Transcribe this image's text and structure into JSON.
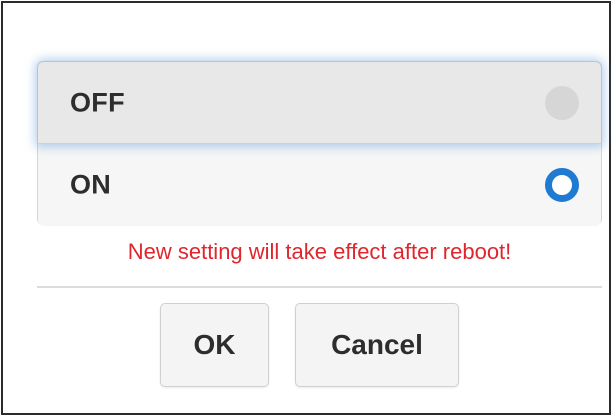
{
  "options": [
    {
      "label": "OFF",
      "selected": false
    },
    {
      "label": "ON",
      "selected": true
    }
  ],
  "notice": "New setting will take effect after reboot!",
  "buttons": {
    "ok_label": "OK",
    "cancel_label": "Cancel"
  },
  "colors": {
    "notice": "#e0262d",
    "radio_selected": "#1f7ad1",
    "radio_unselected": "#d6d6d6"
  }
}
